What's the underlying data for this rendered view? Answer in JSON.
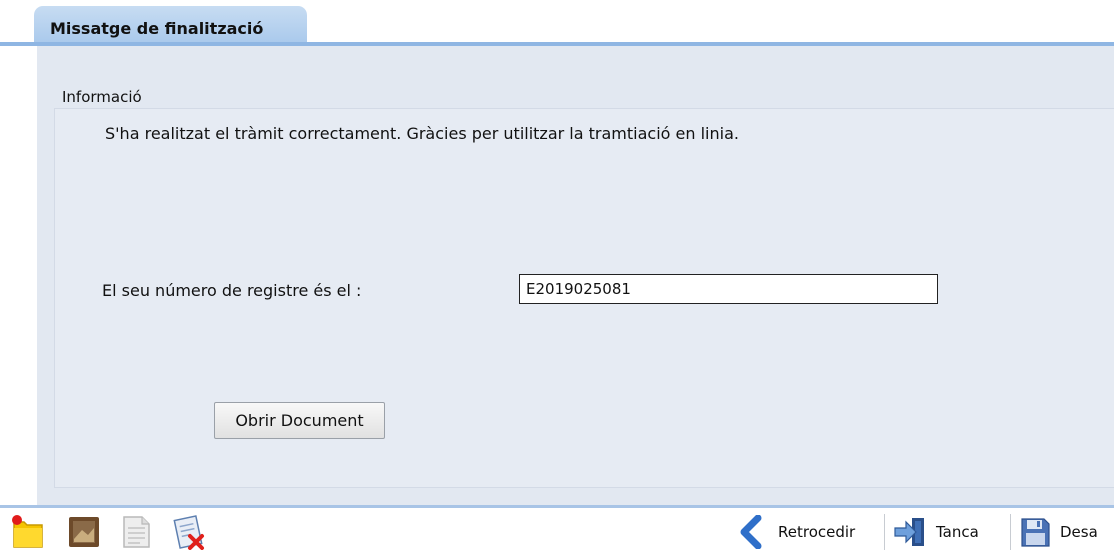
{
  "tab": {
    "title": "Missatge de finalització"
  },
  "panel": {
    "legend": "Informació",
    "message": "S'ha realitzat el tràmit correctament. Gràcies per utilitzar la tramtiació en linia.",
    "registry_label": "El seu número de registre és el :",
    "registry_value": "E2019025081",
    "open_document_label": "Obrir Document"
  },
  "toolbar": {
    "left_icons": [
      "new-note-icon",
      "image-frame-icon",
      "document-page-icon",
      "delete-document-icon"
    ],
    "back_label": "Retrocedir",
    "close_label": "Tanca",
    "save_label": "Desa"
  },
  "colors": {
    "tab_background": "#b3cfee",
    "tab_line": "#8fb6e3",
    "panel_background": "#e2e8f1",
    "back_arrow": "#2f6fc9",
    "save_disk": "#4a72b5"
  }
}
